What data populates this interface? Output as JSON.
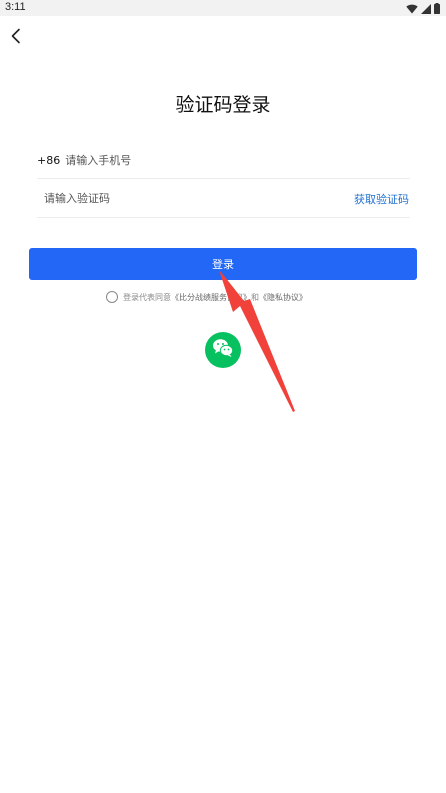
{
  "status_bar": {
    "time": "3:11",
    "icons": [
      "wifi-icon",
      "signal-icon",
      "battery-icon"
    ]
  },
  "header": {
    "back_icon": "chevron-left-icon",
    "title": "验证码登录"
  },
  "form": {
    "country_code": "+86",
    "phone_placeholder": "请输入手机号",
    "phone_value": "",
    "code_placeholder": "请输入验证码",
    "code_value": "",
    "get_code_label": "获取验证码"
  },
  "login_button": {
    "label": "登录"
  },
  "agreement": {
    "checked": false,
    "prefix": "登录代表同意",
    "service_link": "《比分战绩服务协议》",
    "conjunction": "和",
    "privacy_link": "《隐私协议》"
  },
  "social_login": {
    "wechat_icon": "wechat-icon"
  },
  "colors": {
    "primary": "#2367f6",
    "link": "#1f6fd1",
    "wechat": "#07c160",
    "annotation_arrow": "#f0413a",
    "status_bar_bg": "#f2f2f2"
  }
}
